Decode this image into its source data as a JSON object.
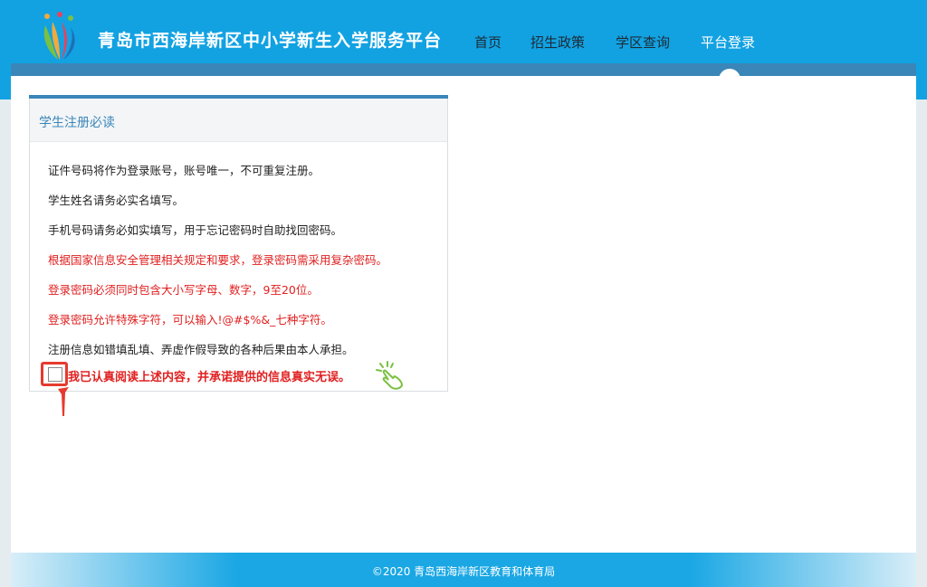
{
  "header": {
    "site_title": "青岛市西海岸新区中小学新生入学服务平台",
    "nav": [
      {
        "label": "首页"
      },
      {
        "label": "招生政策"
      },
      {
        "label": "学区查询"
      },
      {
        "label": "平台登录",
        "active": true
      }
    ],
    "colors": {
      "header_bg": "#12a2e2",
      "strip": "#3a86b8"
    }
  },
  "card": {
    "title": "学生注册必读",
    "rules": [
      {
        "text": "证件号码将作为登录账号，账号唯一，不可重复注册。",
        "color": "#222222"
      },
      {
        "text": "学生姓名请务必实名填写。",
        "color": "#222222"
      },
      {
        "text": "手机号码请务必如实填写，用于忘记密码时自助找回密码。",
        "color": "#222222"
      },
      {
        "text": "根据国家信息安全管理相关规定和要求，登录密码需采用复杂密码。",
        "color": "#e02020"
      },
      {
        "text": "登录密码必须同时包含大小写字母、数字，9至20位。",
        "color": "#e02020"
      },
      {
        "text": "登录密码允许特殊字符，可以输入!@#$%&_七种字符。",
        "color": "#e02020"
      },
      {
        "text": "注册信息如错填乱填、弄虚作假导致的各种后果由本人承担。",
        "color": "#222222"
      }
    ],
    "agree_label": "我已认真阅读上述内容，并承诺提供的信息真实无误。",
    "agree_checked": false
  },
  "footer": {
    "text": "©2020 青岛西海岸新区教育和体育局"
  }
}
